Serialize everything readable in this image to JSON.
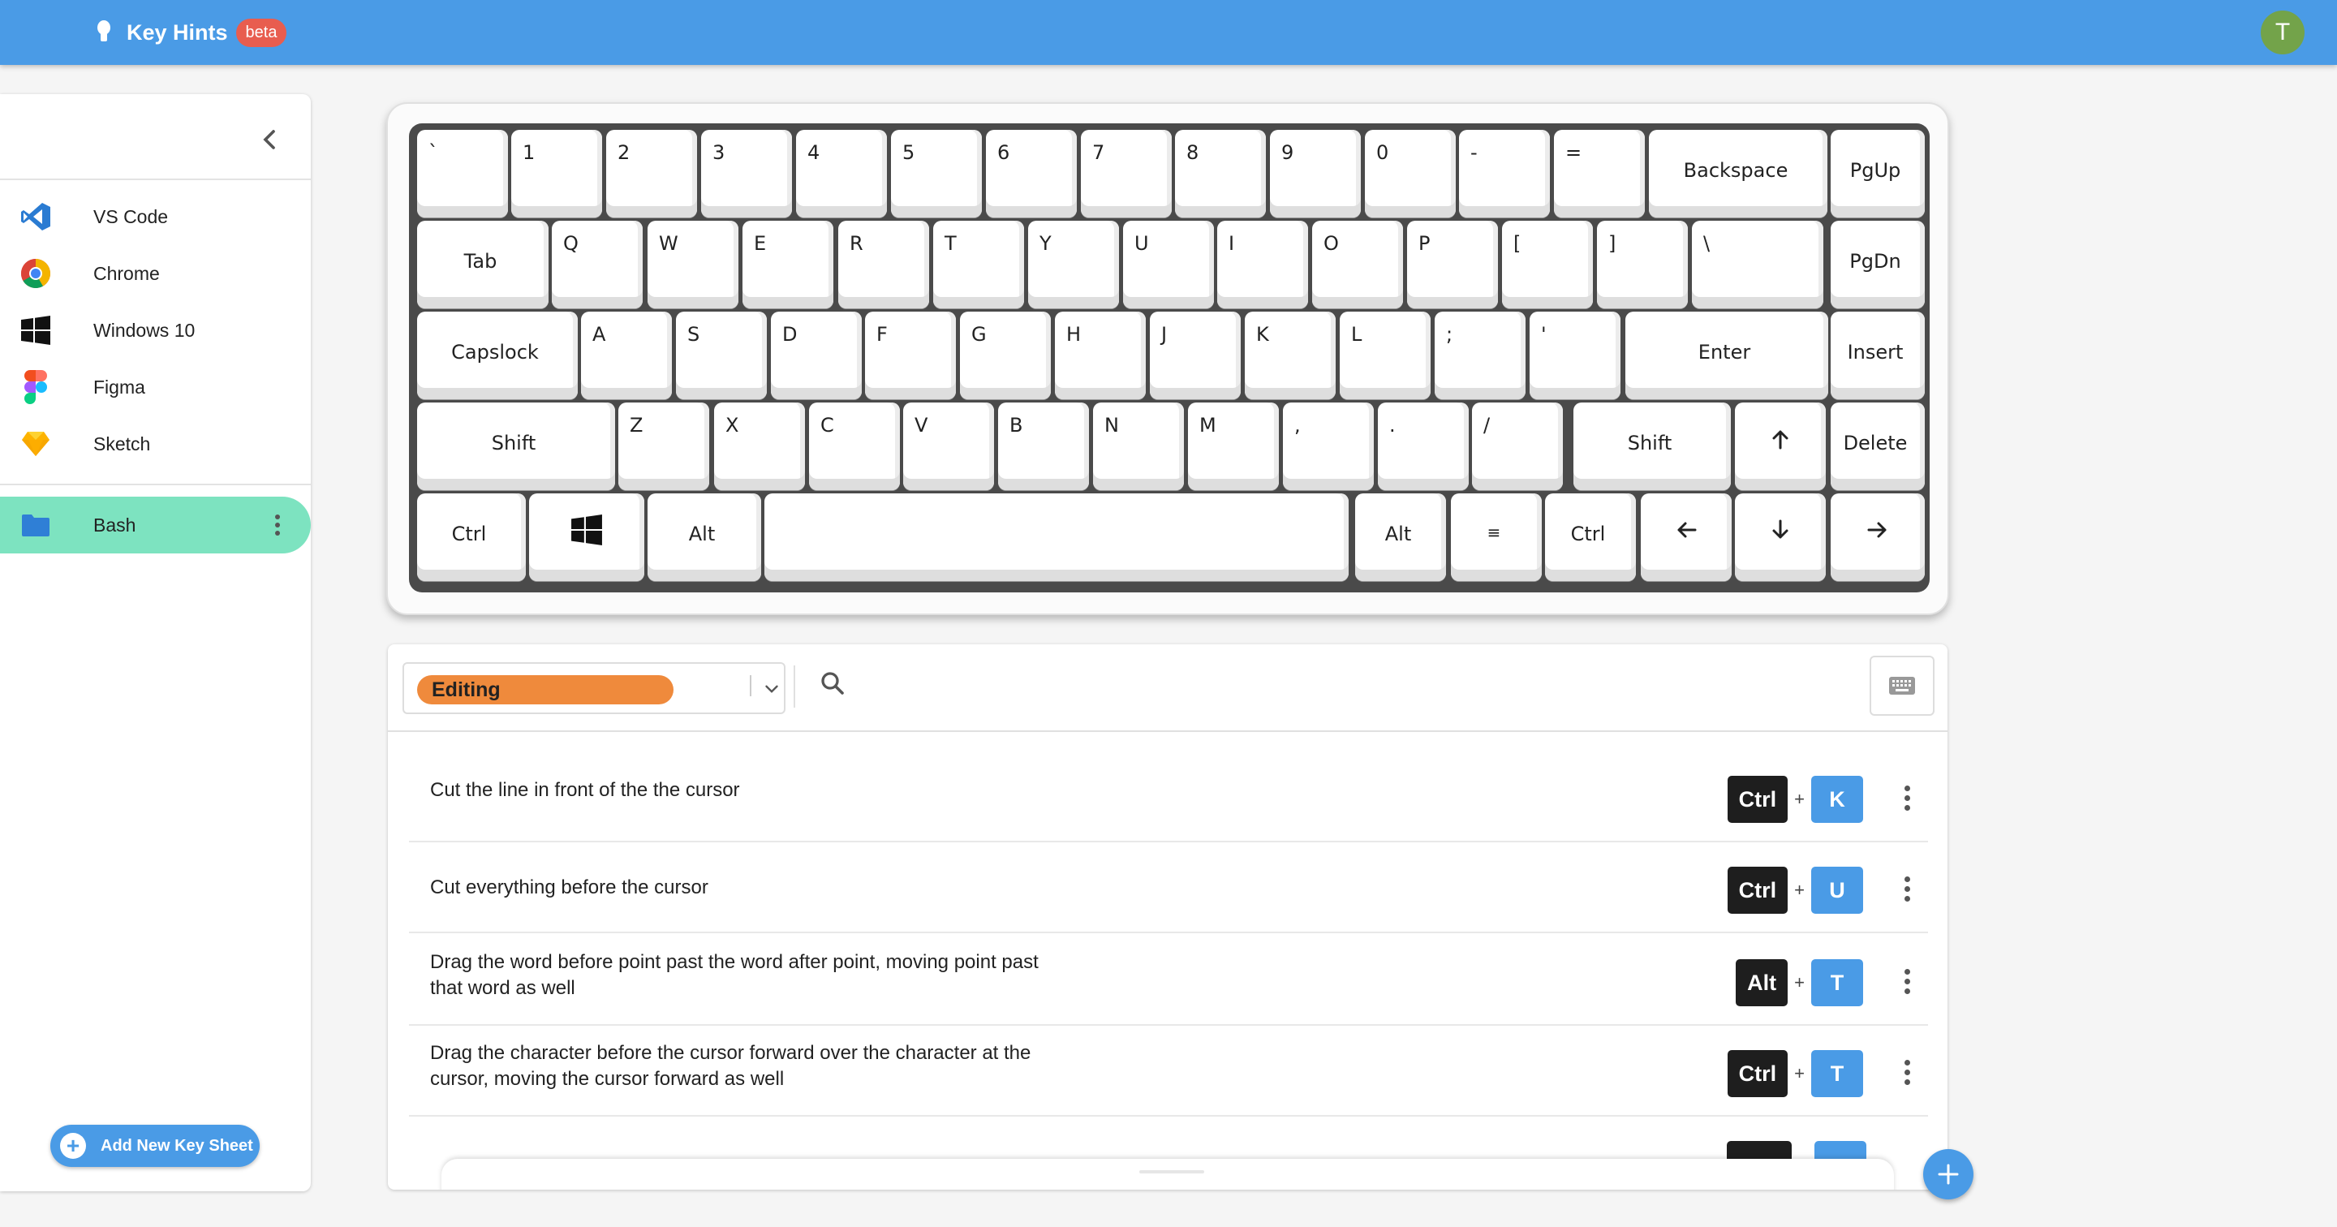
{
  "app": {
    "title": "Key Hints",
    "badge": "beta",
    "avatar_initial": "T"
  },
  "colors": {
    "topbar": "#4a9be6",
    "active_item": "#7de3c0",
    "category_chip": "#ef8a3c",
    "badge": "#e85d4f",
    "avatar": "#73a34a"
  },
  "sidebar": {
    "collapse_icon": "chevron-left-icon",
    "apps": [
      {
        "label": "VS Code",
        "icon": "vscode-icon"
      },
      {
        "label": "Chrome",
        "icon": "chrome-icon"
      },
      {
        "label": "Windows 10",
        "icon": "windows-icon"
      },
      {
        "label": "Figma",
        "icon": "figma-icon"
      },
      {
        "label": "Sketch",
        "icon": "sketch-icon"
      }
    ],
    "sheets": [
      {
        "label": "Bash",
        "icon": "folder-icon",
        "active": true
      }
    ],
    "add_button": "Add New Key Sheet"
  },
  "keyboard": {
    "rows": [
      [
        "`",
        "1",
        "2",
        "3",
        "4",
        "5",
        "6",
        "7",
        "8",
        "9",
        "0",
        "-",
        "=",
        "Backspace",
        "PgUp"
      ],
      [
        "Tab",
        "Q",
        "W",
        "E",
        "R",
        "T",
        "Y",
        "U",
        "I",
        "O",
        "P",
        "[",
        "]",
        "\\",
        "PgDn"
      ],
      [
        "Capslock",
        "A",
        "S",
        "D",
        "F",
        "G",
        "H",
        "J",
        "K",
        "L",
        ";",
        "'",
        "Enter",
        "Insert"
      ],
      [
        "Shift",
        "Z",
        "X",
        "C",
        "V",
        "B",
        "N",
        "M",
        ",",
        ".",
        "/",
        "Shift",
        "↑",
        "Delete"
      ],
      [
        "Ctrl",
        "⊞",
        "Alt",
        "",
        "Alt",
        "≡",
        "Ctrl",
        "←",
        "↓",
        "→"
      ]
    ]
  },
  "filter": {
    "category": "Editing",
    "search_icon": "search-icon",
    "keyboard_toggle_icon": "keyboard-icon"
  },
  "shortcuts": [
    {
      "description": "Cut the line in front of the the cursor",
      "keys": [
        "Ctrl",
        "K"
      ]
    },
    {
      "description": "Cut everything before the cursor",
      "keys": [
        "Ctrl",
        "U"
      ]
    },
    {
      "description": "Drag the word before point past the word after point, moving point past that word as well",
      "keys": [
        "Alt",
        "T"
      ]
    },
    {
      "description": "Drag the character before the cursor forward over the character at the cursor, moving the cursor forward as well",
      "keys": [
        "Ctrl",
        "T"
      ]
    }
  ],
  "plus_sign": "+"
}
